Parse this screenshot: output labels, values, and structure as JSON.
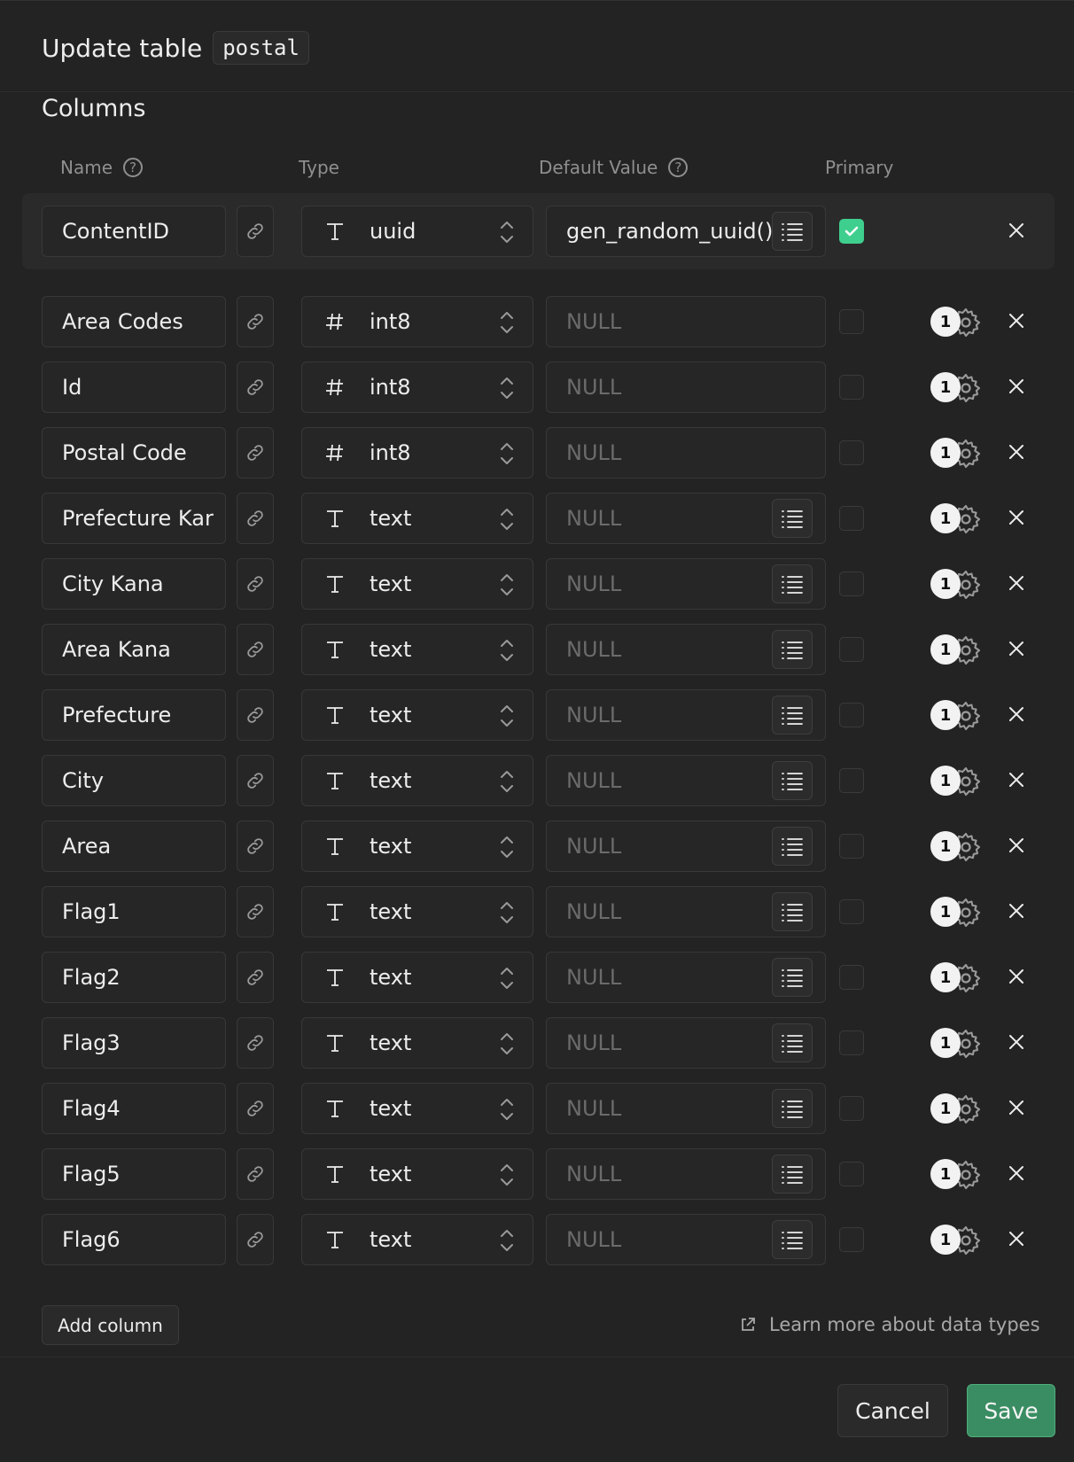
{
  "header": {
    "title": "Update table",
    "table_name": "postal"
  },
  "columns_section": {
    "title": "Columns"
  },
  "column_headers": {
    "name": "Name",
    "type": "Type",
    "default_value": "Default Value",
    "primary": "Primary"
  },
  "columns": [
    {
      "name": "ContentID",
      "type_icon": "text-type-icon",
      "type": "uuid",
      "default": "gen_random_uuid()",
      "default_is_value": true,
      "has_list": true,
      "primary": true,
      "gear_badge": ""
    },
    {
      "name": "Area Codes",
      "type_icon": "hash-icon",
      "type": "int8",
      "default": "NULL",
      "default_is_value": false,
      "has_list": false,
      "primary": false,
      "gear_badge": "1"
    },
    {
      "name": "Id",
      "type_icon": "hash-icon",
      "type": "int8",
      "default": "NULL",
      "default_is_value": false,
      "has_list": false,
      "primary": false,
      "gear_badge": "1"
    },
    {
      "name": "Postal Code",
      "type_icon": "hash-icon",
      "type": "int8",
      "default": "NULL",
      "default_is_value": false,
      "has_list": false,
      "primary": false,
      "gear_badge": "1"
    },
    {
      "name": "Prefecture Kar",
      "type_icon": "text-type-icon",
      "type": "text",
      "default": "NULL",
      "default_is_value": false,
      "has_list": true,
      "primary": false,
      "gear_badge": "1"
    },
    {
      "name": "City Kana",
      "type_icon": "text-type-icon",
      "type": "text",
      "default": "NULL",
      "default_is_value": false,
      "has_list": true,
      "primary": false,
      "gear_badge": "1"
    },
    {
      "name": "Area Kana",
      "type_icon": "text-type-icon",
      "type": "text",
      "default": "NULL",
      "default_is_value": false,
      "has_list": true,
      "primary": false,
      "gear_badge": "1"
    },
    {
      "name": "Prefecture",
      "type_icon": "text-type-icon",
      "type": "text",
      "default": "NULL",
      "default_is_value": false,
      "has_list": true,
      "primary": false,
      "gear_badge": "1"
    },
    {
      "name": "City",
      "type_icon": "text-type-icon",
      "type": "text",
      "default": "NULL",
      "default_is_value": false,
      "has_list": true,
      "primary": false,
      "gear_badge": "1"
    },
    {
      "name": "Area",
      "type_icon": "text-type-icon",
      "type": "text",
      "default": "NULL",
      "default_is_value": false,
      "has_list": true,
      "primary": false,
      "gear_badge": "1"
    },
    {
      "name": "Flag1",
      "type_icon": "text-type-icon",
      "type": "text",
      "default": "NULL",
      "default_is_value": false,
      "has_list": true,
      "primary": false,
      "gear_badge": "1"
    },
    {
      "name": "Flag2",
      "type_icon": "text-type-icon",
      "type": "text",
      "default": "NULL",
      "default_is_value": false,
      "has_list": true,
      "primary": false,
      "gear_badge": "1"
    },
    {
      "name": "Flag3",
      "type_icon": "text-type-icon",
      "type": "text",
      "default": "NULL",
      "default_is_value": false,
      "has_list": true,
      "primary": false,
      "gear_badge": "1"
    },
    {
      "name": "Flag4",
      "type_icon": "text-type-icon",
      "type": "text",
      "default": "NULL",
      "default_is_value": false,
      "has_list": true,
      "primary": false,
      "gear_badge": "1"
    },
    {
      "name": "Flag5",
      "type_icon": "text-type-icon",
      "type": "text",
      "default": "NULL",
      "default_is_value": false,
      "has_list": true,
      "primary": false,
      "gear_badge": "1"
    },
    {
      "name": "Flag6",
      "type_icon": "text-type-icon",
      "type": "text",
      "default": "NULL",
      "default_is_value": false,
      "has_list": true,
      "primary": false,
      "gear_badge": "1"
    }
  ],
  "footer": {
    "add_column": "Add column",
    "learn_more": "Learn more about data types",
    "cancel": "Cancel",
    "save": "Save"
  },
  "colors": {
    "accent": "#3ecf8e",
    "save_bg": "#3a8d62",
    "background": "#232323"
  }
}
